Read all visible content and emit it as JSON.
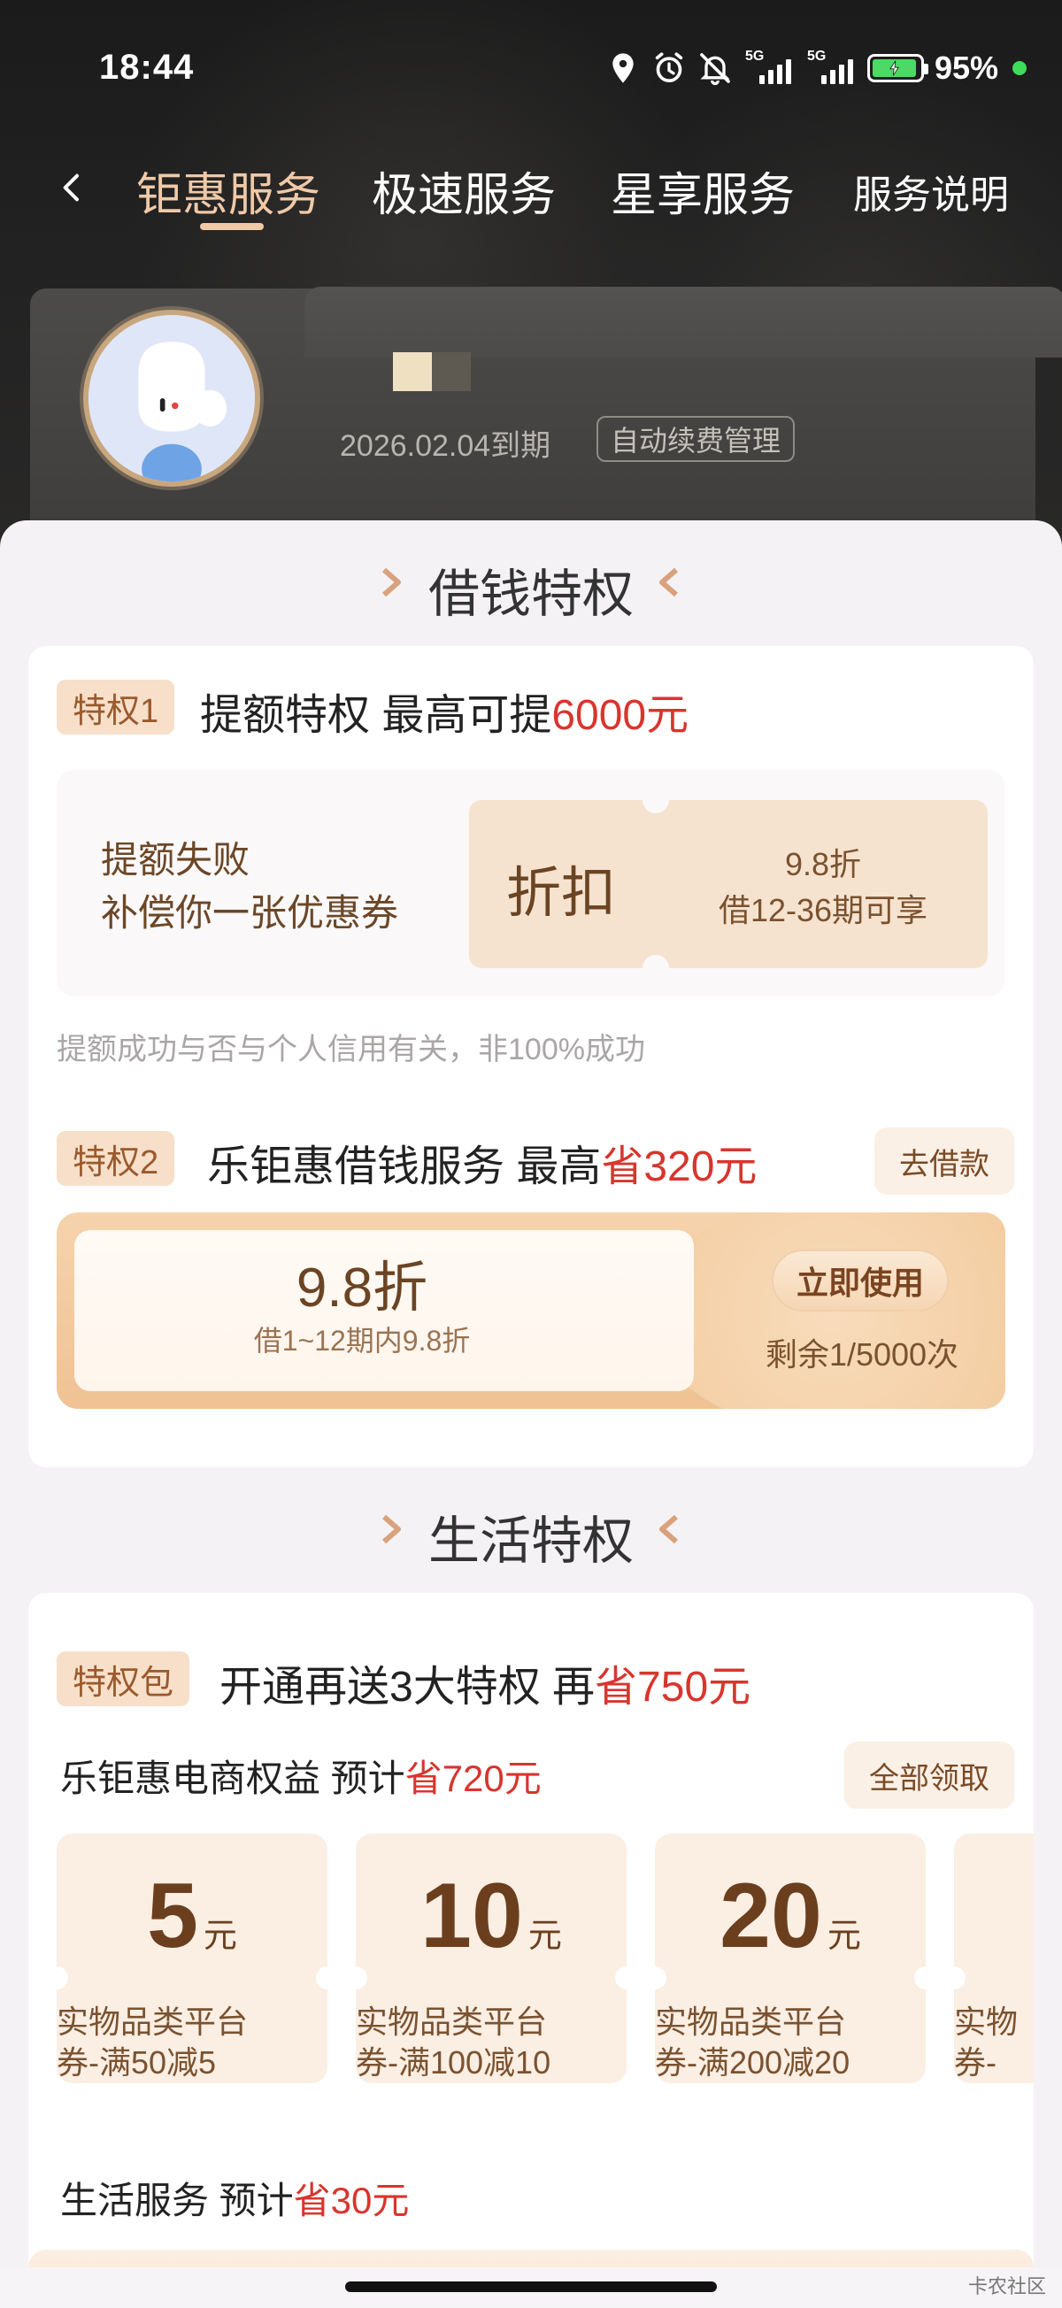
{
  "status_bar": {
    "time": "18:44",
    "network_1": "5G",
    "network_2": "5G",
    "battery_percent": "95%",
    "battery_level": 0.95
  },
  "nav": {
    "tabs": [
      {
        "label": "钜惠服务",
        "active": true
      },
      {
        "label": "极速服务",
        "active": false
      },
      {
        "label": "星享服务",
        "active": false
      }
    ],
    "help_label": "服务说明"
  },
  "member": {
    "expire_text": "2026.02.04到期",
    "auto_renew_label": "自动续费管理"
  },
  "borrow_section": {
    "title": "借钱特权",
    "privilege_1": {
      "badge": "特权1",
      "title_prefix": "提额特权  最高可提",
      "title_highlight": "6000元",
      "fail_line_1": "提额失败",
      "fail_line_2": "补偿你一张优惠券",
      "coupon_type": "折扣",
      "coupon_discount": "9.8折",
      "coupon_condition": "借12-36期可享",
      "note": "提额成功与否与个人信用有关，非100%成功"
    },
    "privilege_2": {
      "badge": "特权2",
      "title_prefix": "乐钜惠借钱服务  最高",
      "title_highlight": "省320元",
      "action_label": "去借款",
      "coupon_discount": "9.8折",
      "coupon_condition": "借1~12期内9.8折",
      "use_label": "立即使用",
      "remaining": "剩余1/5000次"
    }
  },
  "life_section": {
    "title": "生活特权",
    "package_badge": "特权包",
    "package_title_prefix": "开通再送3大特权  再",
    "package_title_highlight": "省750元",
    "ecommerce_title_prefix": "乐钜惠电商权益  预计",
    "ecommerce_title_highlight": "省720元",
    "claim_all_label": "全部领取",
    "coupons": [
      {
        "amount": "5",
        "unit": "元",
        "desc_1": "实物品类平台",
        "desc_2": "券-满50减5"
      },
      {
        "amount": "10",
        "unit": "元",
        "desc_1": "实物品类平台",
        "desc_2": "券-满100减10"
      },
      {
        "amount": "20",
        "unit": "元",
        "desc_1": "实物品类平台",
        "desc_2": "券-满200减20"
      },
      {
        "amount": "",
        "unit": "",
        "desc_1": "实物",
        "desc_2": "券-"
      }
    ],
    "life_service_prefix": "生活服务  预计",
    "life_service_highlight": "省30元"
  },
  "watermark": "卡农社区",
  "colors": {
    "accent_gold": "#f0c9a8",
    "highlight_red": "#d8352e",
    "coupon_brown": "#6b4424"
  }
}
